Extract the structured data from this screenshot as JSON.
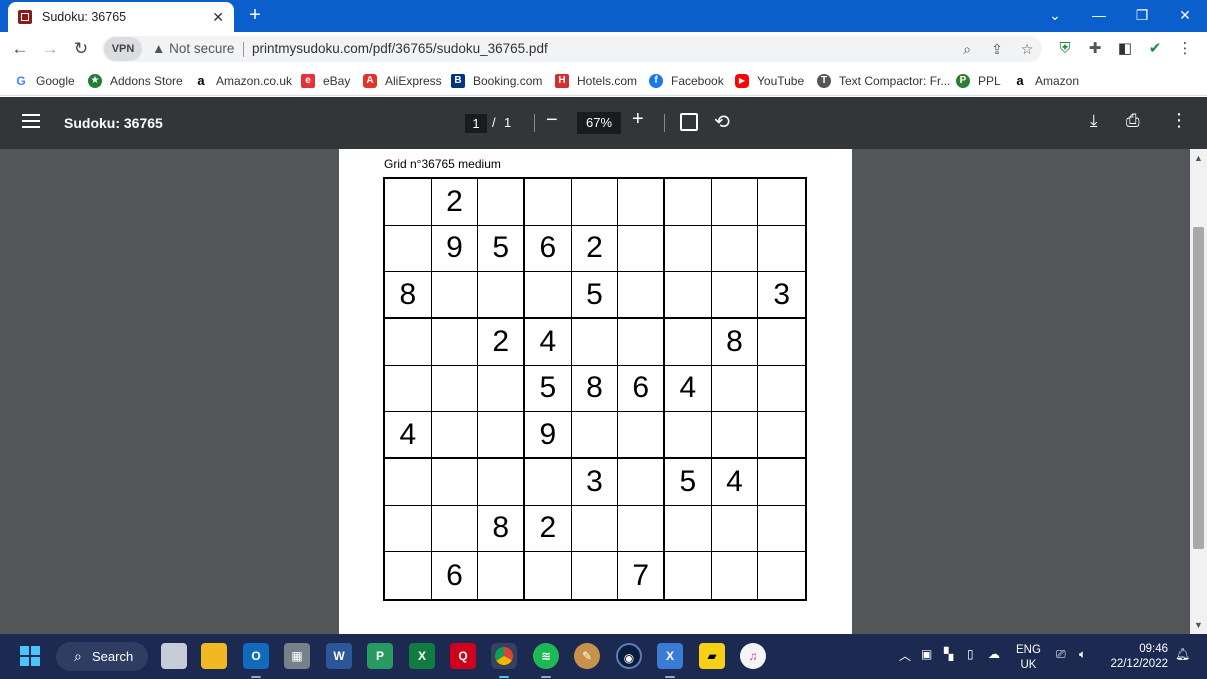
{
  "browser": {
    "tab_title": "Sudoku: 36765",
    "tab_close": "✕",
    "new_tab": "+",
    "vpn_label": "VPN",
    "not_secure": "Not secure",
    "url": "printmysudoku.com/pdf/36765/sudoku_36765.pdf"
  },
  "bookmarks": [
    {
      "label": "Google",
      "icon": "google-icon",
      "color": "#ffffff",
      "glyph": "G",
      "glyph_color": "#4285f4"
    },
    {
      "label": "Addons Store",
      "icon": "addons-icon",
      "color": "#1e7e34",
      "glyph": "★",
      "glyph_color": "#ffffff"
    },
    {
      "label": "Amazon.co.uk",
      "icon": "amazon-icon",
      "color": "#ffffff",
      "glyph": "a",
      "glyph_color": "#000000"
    },
    {
      "label": "eBay",
      "icon": "ebay-icon",
      "color": "#e53238",
      "glyph": "e",
      "glyph_color": "#ffffff"
    },
    {
      "label": "AliExpress",
      "icon": "aliexpress-icon",
      "color": "#e43225",
      "glyph": "A",
      "glyph_color": "#ffffff"
    },
    {
      "label": "Booking.com",
      "icon": "booking-icon",
      "color": "#003580",
      "glyph": "B",
      "glyph_color": "#ffffff"
    },
    {
      "label": "Hotels.com",
      "icon": "hotels-icon",
      "color": "#d32f2f",
      "glyph": "H",
      "glyph_color": "#ffffff"
    },
    {
      "label": "Facebook",
      "icon": "facebook-icon",
      "color": "#1877f2",
      "glyph": "f",
      "glyph_color": "#ffffff"
    },
    {
      "label": "YouTube",
      "icon": "youtube-icon",
      "color": "#ff0000",
      "glyph": "▶",
      "glyph_color": "#ffffff"
    },
    {
      "label": "Text Compactor: Fr...",
      "icon": "textcompactor-icon",
      "color": "#555555",
      "glyph": "T",
      "glyph_color": "#ffffff"
    },
    {
      "label": "PPL",
      "icon": "ppl-icon",
      "color": "#2e7d32",
      "glyph": "P",
      "glyph_color": "#ffffff"
    },
    {
      "label": "Amazon",
      "icon": "amazon-icon",
      "color": "#ffffff",
      "glyph": "a",
      "glyph_color": "#000000"
    }
  ],
  "pdf": {
    "title": "Sudoku: 36765",
    "page_current": "1",
    "page_sep": "/",
    "page_total": "1",
    "zoom": "67%",
    "grid_label": "Grid n°36765 medium"
  },
  "sudoku": [
    [
      "",
      "2",
      "",
      "",
      "",
      "",
      "",
      "",
      ""
    ],
    [
      "",
      "9",
      "5",
      "6",
      "2",
      "",
      "",
      "",
      ""
    ],
    [
      "8",
      "",
      "",
      "",
      "5",
      "",
      "",
      "",
      "3"
    ],
    [
      "",
      "",
      "2",
      "4",
      "",
      "",
      "",
      "8",
      ""
    ],
    [
      "",
      "",
      "",
      "5",
      "8",
      "6",
      "4",
      "",
      ""
    ],
    [
      "4",
      "",
      "",
      "9",
      "",
      "",
      "",
      "",
      ""
    ],
    [
      "",
      "",
      "",
      "",
      "3",
      "",
      "5",
      "4",
      ""
    ],
    [
      "",
      "",
      "8",
      "2",
      "",
      "",
      "",
      "",
      ""
    ],
    [
      "",
      "6",
      "",
      "",
      "",
      "7",
      "",
      "",
      ""
    ]
  ],
  "taskbar": {
    "search_label": "Search",
    "lang_top": "ENG",
    "lang_bottom": "UK",
    "time": "09:46",
    "date": "22/12/2022"
  },
  "colors": {
    "tabstrip": "#0b5fcc",
    "pdf_toolbar": "#323639",
    "pdf_background": "#525659",
    "taskbar": "#1c2a52"
  }
}
